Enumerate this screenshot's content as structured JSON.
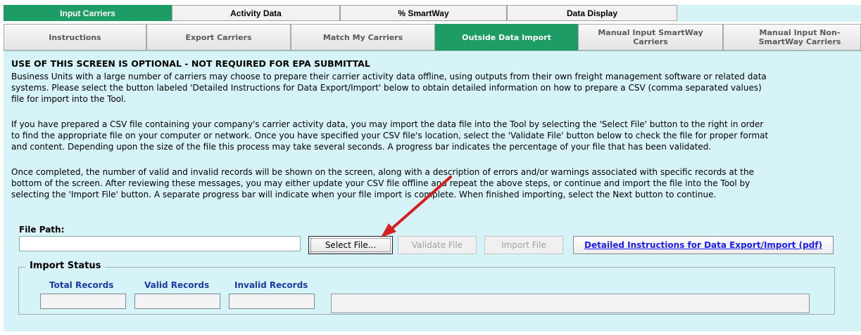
{
  "top_tabs": [
    {
      "label": "Input Carriers",
      "active": true
    },
    {
      "label": "Activity Data",
      "active": false
    },
    {
      "label": "% SmartWay",
      "active": false
    },
    {
      "label": "Data Display",
      "active": false
    }
  ],
  "sub_tabs": [
    {
      "label": "Instructions",
      "active": false
    },
    {
      "label": "Export Carriers",
      "active": false
    },
    {
      "label": "Match My Carriers",
      "active": false
    },
    {
      "label": "Outside Data Import",
      "active": true
    },
    {
      "label": "Manual Input SmartWay Carriers",
      "active": false
    },
    {
      "label": "Manual Input Non-SmartWay Carriers",
      "active": false
    }
  ],
  "content": {
    "heading": "USE OF THIS SCREEN IS OPTIONAL - NOT REQUIRED FOR EPA SUBMITTAL",
    "paragraph1": "Business Units with a large number of carriers may choose to prepare their carrier activity data offline, using outputs from their own freight management software or related data\nsystems.  Please select the button labeled 'Detailed Instructions for Data Export/Import' below to obtain detailed information on how to prepare a CSV (comma separated values)\nfile for import into the Tool.",
    "paragraph2": "If you have prepared a CSV file containing your company's carrier activity data, you may import the data file into the Tool by selecting the 'Select File' button to the right in order\nto find the appropriate file on your computer or network. Once you have specified your CSV file's location, select the 'Validate File' button below to check the file for proper format\nand content.  Depending upon the size of the file this process may take several seconds.  A progress bar indicates the percentage of your file that has been validated.",
    "paragraph3": "Once completed, the number of valid and invalid records will be shown on the screen, along with a description of errors and/or warnings associated with specific records at the\nbottom of the screen.  After reviewing these messages, you may either update your CSV file offline and repeat the above steps, or continue and import the file into the Tool by\nselecting the 'Import File' button. A separate progress bar will indicate when your file import is complete. When finished importing, select the Next button to continue."
  },
  "file": {
    "path_label": "File Path:",
    "path_value": "",
    "select_label": "Select File...",
    "validate_label": "Validate File",
    "import_label": "Import File",
    "instructions_label": "Detailed Instructions for Data Export/Import (pdf)"
  },
  "status": {
    "title": "Import Status",
    "total_label": "Total Records",
    "valid_label": "Valid Records",
    "invalid_label": "Invalid Records",
    "total_value": "",
    "valid_value": "",
    "invalid_value": "",
    "message": ""
  },
  "colors": {
    "active_tab": "#1e9c66",
    "panel_bg": "#d6f3f8",
    "link": "#1a1aff",
    "status_label": "#1a3aa8",
    "annotation_arrow": "#d42020"
  }
}
